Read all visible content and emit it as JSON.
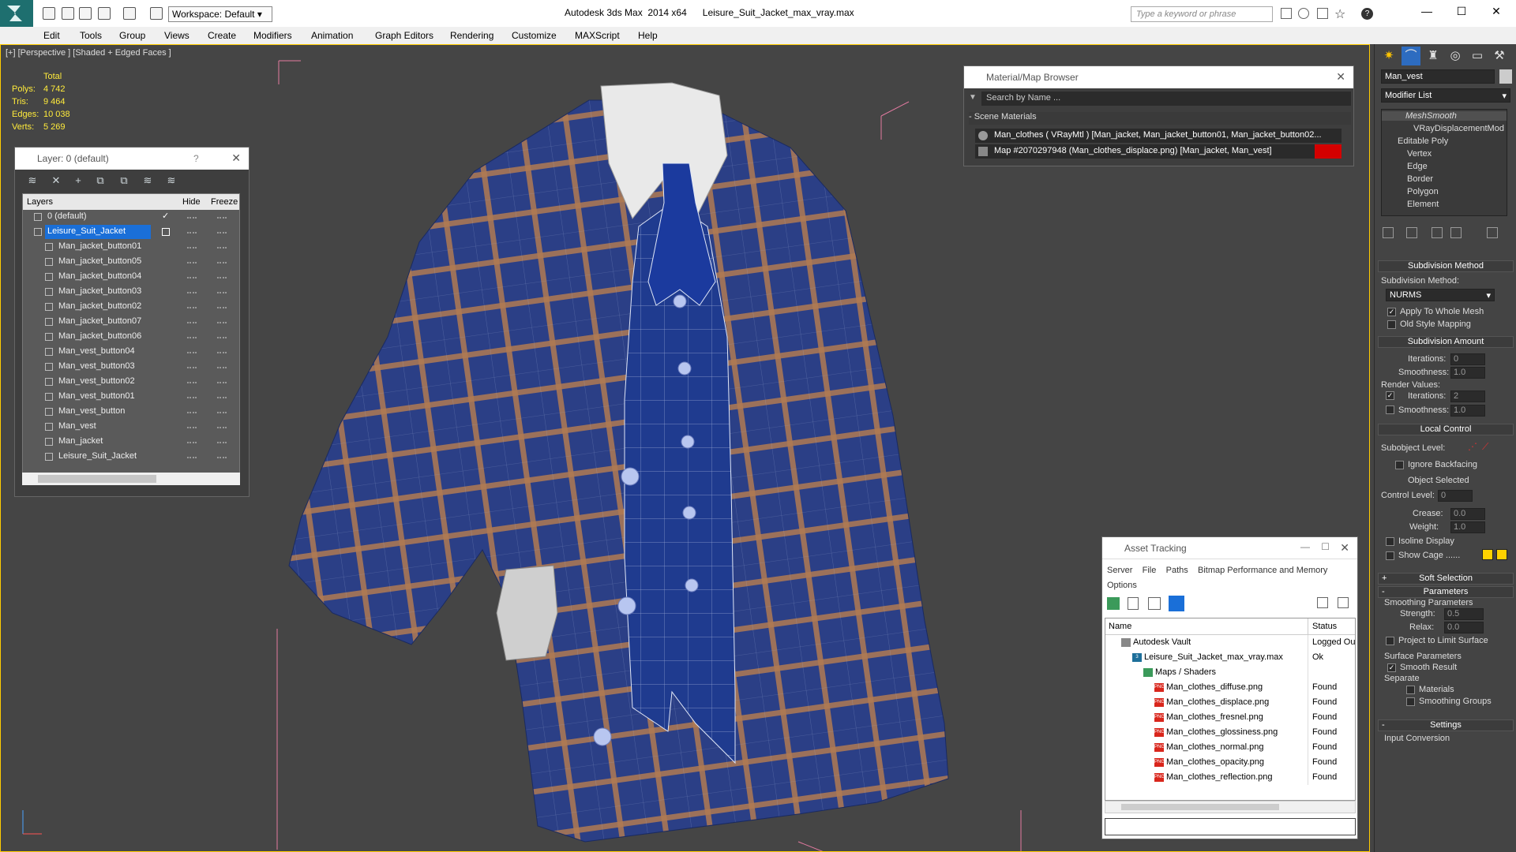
{
  "titlebar": {
    "workspace": "Workspace: Default",
    "app_title": "Autodesk 3ds Max  2014 x64",
    "file_name": "Leisure_Suit_Jacket_max_vray.max",
    "search_placeholder": "Type a keyword or phrase"
  },
  "menu": [
    "Edit",
    "Tools",
    "Group",
    "Views",
    "Create",
    "Modifiers",
    "Animation",
    "Graph Editors",
    "Rendering",
    "Customize",
    "MAXScript",
    "Help"
  ],
  "viewport": {
    "label": "[+] [Perspective ] [Shaded + Edged Faces ]",
    "stats_header": "Total",
    "stats": [
      {
        "k": "Polys:",
        "v": "4 742"
      },
      {
        "k": "Tris:",
        "v": "9 464"
      },
      {
        "k": "Edges:",
        "v": "10 038"
      },
      {
        "k": "Verts:",
        "v": "5 269"
      }
    ]
  },
  "layer_panel": {
    "title": "Layer: 0 (default)",
    "help": "?",
    "col_layers": "Layers",
    "col_hide": "Hide",
    "col_freeze": "Freeze",
    "rows": [
      {
        "name": "0 (default)",
        "indent": 1,
        "check": true
      },
      {
        "name": "Leisure_Suit_Jacket",
        "indent": 1,
        "selected": true
      },
      {
        "name": "Man_jacket_button01",
        "indent": 2
      },
      {
        "name": "Man_jacket_button05",
        "indent": 2
      },
      {
        "name": "Man_jacket_button04",
        "indent": 2
      },
      {
        "name": "Man_jacket_button03",
        "indent": 2
      },
      {
        "name": "Man_jacket_button02",
        "indent": 2
      },
      {
        "name": "Man_jacket_button07",
        "indent": 2
      },
      {
        "name": "Man_jacket_button06",
        "indent": 2
      },
      {
        "name": "Man_vest_button04",
        "indent": 2
      },
      {
        "name": "Man_vest_button03",
        "indent": 2
      },
      {
        "name": "Man_vest_button02",
        "indent": 2
      },
      {
        "name": "Man_vest_button01",
        "indent": 2
      },
      {
        "name": "Man_vest_button",
        "indent": 2
      },
      {
        "name": "Man_vest",
        "indent": 2
      },
      {
        "name": "Man_jacket",
        "indent": 2
      },
      {
        "name": "Leisure_Suit_Jacket",
        "indent": 2
      }
    ]
  },
  "material_browser": {
    "title": "Material/Map Browser",
    "search": "Search by Name ...",
    "section": "- Scene Materials",
    "rows": [
      "Man_clothes  ( VRayMtl ) [Man_jacket, Man_jacket_button01, Man_jacket_button02...",
      "Map #2070297948 (Man_clothes_displace.png) [Man_jacket, Man_vest]"
    ]
  },
  "asset_tracking": {
    "title": "Asset Tracking",
    "menu_row1": [
      "Server",
      "File",
      "Paths",
      "Bitmap Performance and Memory"
    ],
    "menu_row2": [
      "Options"
    ],
    "col_name": "Name",
    "col_status": "Status",
    "rows": [
      {
        "name": "Autodesk Vault",
        "status": "Logged Ou",
        "indent": 0
      },
      {
        "name": "Leisure_Suit_Jacket_max_vray.max",
        "status": "Ok",
        "indent": 1
      },
      {
        "name": "Maps / Shaders",
        "status": "",
        "indent": 2
      },
      {
        "name": "Man_clothes_diffuse.png",
        "status": "Found",
        "indent": 3
      },
      {
        "name": "Man_clothes_displace.png",
        "status": "Found",
        "indent": 3
      },
      {
        "name": "Man_clothes_fresnel.png",
        "status": "Found",
        "indent": 3
      },
      {
        "name": "Man_clothes_glossiness.png",
        "status": "Found",
        "indent": 3
      },
      {
        "name": "Man_clothes_normal.png",
        "status": "Found",
        "indent": 3
      },
      {
        "name": "Man_clothes_opacity.png",
        "status": "Found",
        "indent": 3
      },
      {
        "name": "Man_clothes_reflection.png",
        "status": "Found",
        "indent": 3
      }
    ]
  },
  "command_panel": {
    "object_name": "Man_vest",
    "modifier_list": "Modifier List",
    "stack": [
      "MeshSmooth",
      "VRayDisplacementMod",
      "Editable Poly",
      "Vertex",
      "Edge",
      "Border",
      "Polygon",
      "Element"
    ],
    "subdivision_method_title": "Subdivision Method",
    "subdivision_method_label": "Subdivision Method:",
    "subdivision_method_value": "NURMS",
    "apply_whole_mesh": "Apply To Whole Mesh",
    "old_style_mapping": "Old Style Mapping",
    "subdivision_amount_title": "Subdivision Amount",
    "iterations_label": "Iterations:",
    "iterations_value": "0",
    "smoothness_label": "Smoothness:",
    "smoothness_value": "1.0",
    "render_values": "Render Values:",
    "render_iterations_label": "Iterations:",
    "render_iterations_value": "2",
    "render_smoothness_label": "Smoothness:",
    "render_smoothness_value": "1.0",
    "local_control_title": "Local Control",
    "subobject_level": "Subobject Level:",
    "ignore_backfacing": "Ignore Backfacing",
    "object_selected": "Object Selected",
    "control_level_label": "Control Level:",
    "control_level_value": "0",
    "crease_label": "Crease:",
    "crease_value": "0.0",
    "weight_label": "Weight:",
    "weight_value": "1.0",
    "isoline_display": "Isoline Display",
    "show_cage": "Show Cage ......",
    "soft_selection_title": "Soft Selection",
    "parameters_title": "Parameters",
    "smoothing_parameters": "Smoothing Parameters",
    "strength_label": "Strength:",
    "strength_value": "0.5",
    "relax_label": "Relax:",
    "relax_value": "0.0",
    "project_limit": "Project to Limit Surface",
    "surface_parameters": "Surface Parameters",
    "smooth_result": "Smooth Result",
    "separate": "Separate",
    "materials": "Materials",
    "smoothing_groups": "Smoothing Groups",
    "settings_title": "Settings",
    "input_conversion": "Input Conversion"
  },
  "colors": {
    "accent": "#1a6fd8",
    "cloth": "#2a3f8a",
    "plaid": "#b07a52",
    "vest": "#1f3b8f"
  }
}
